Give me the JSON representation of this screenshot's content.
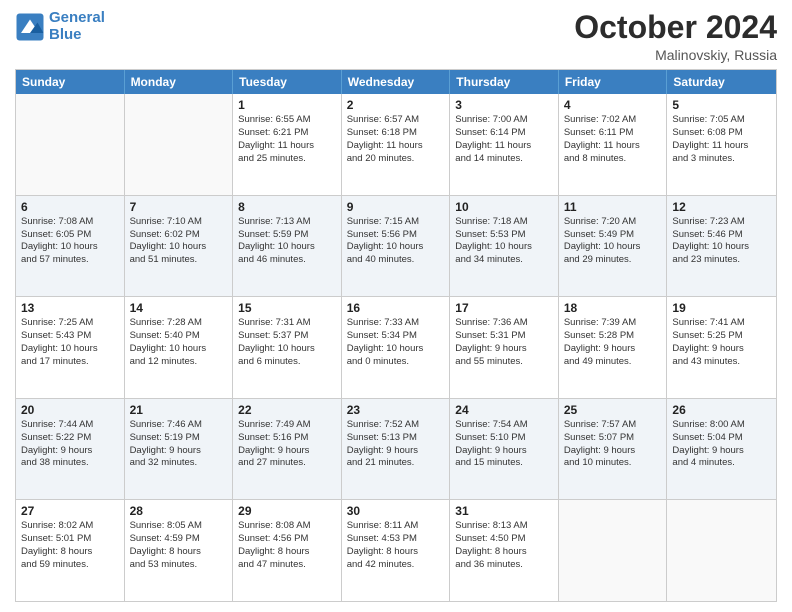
{
  "header": {
    "logo_line1": "General",
    "logo_line2": "Blue",
    "month": "October 2024",
    "location": "Malinovskiy, Russia"
  },
  "weekdays": [
    "Sunday",
    "Monday",
    "Tuesday",
    "Wednesday",
    "Thursday",
    "Friday",
    "Saturday"
  ],
  "rows": [
    [
      {
        "day": "",
        "detail": ""
      },
      {
        "day": "",
        "detail": ""
      },
      {
        "day": "1",
        "detail": "Sunrise: 6:55 AM\nSunset: 6:21 PM\nDaylight: 11 hours\nand 25 minutes."
      },
      {
        "day": "2",
        "detail": "Sunrise: 6:57 AM\nSunset: 6:18 PM\nDaylight: 11 hours\nand 20 minutes."
      },
      {
        "day": "3",
        "detail": "Sunrise: 7:00 AM\nSunset: 6:14 PM\nDaylight: 11 hours\nand 14 minutes."
      },
      {
        "day": "4",
        "detail": "Sunrise: 7:02 AM\nSunset: 6:11 PM\nDaylight: 11 hours\nand 8 minutes."
      },
      {
        "day": "5",
        "detail": "Sunrise: 7:05 AM\nSunset: 6:08 PM\nDaylight: 11 hours\nand 3 minutes."
      }
    ],
    [
      {
        "day": "6",
        "detail": "Sunrise: 7:08 AM\nSunset: 6:05 PM\nDaylight: 10 hours\nand 57 minutes."
      },
      {
        "day": "7",
        "detail": "Sunrise: 7:10 AM\nSunset: 6:02 PM\nDaylight: 10 hours\nand 51 minutes."
      },
      {
        "day": "8",
        "detail": "Sunrise: 7:13 AM\nSunset: 5:59 PM\nDaylight: 10 hours\nand 46 minutes."
      },
      {
        "day": "9",
        "detail": "Sunrise: 7:15 AM\nSunset: 5:56 PM\nDaylight: 10 hours\nand 40 minutes."
      },
      {
        "day": "10",
        "detail": "Sunrise: 7:18 AM\nSunset: 5:53 PM\nDaylight: 10 hours\nand 34 minutes."
      },
      {
        "day": "11",
        "detail": "Sunrise: 7:20 AM\nSunset: 5:49 PM\nDaylight: 10 hours\nand 29 minutes."
      },
      {
        "day": "12",
        "detail": "Sunrise: 7:23 AM\nSunset: 5:46 PM\nDaylight: 10 hours\nand 23 minutes."
      }
    ],
    [
      {
        "day": "13",
        "detail": "Sunrise: 7:25 AM\nSunset: 5:43 PM\nDaylight: 10 hours\nand 17 minutes."
      },
      {
        "day": "14",
        "detail": "Sunrise: 7:28 AM\nSunset: 5:40 PM\nDaylight: 10 hours\nand 12 minutes."
      },
      {
        "day": "15",
        "detail": "Sunrise: 7:31 AM\nSunset: 5:37 PM\nDaylight: 10 hours\nand 6 minutes."
      },
      {
        "day": "16",
        "detail": "Sunrise: 7:33 AM\nSunset: 5:34 PM\nDaylight: 10 hours\nand 0 minutes."
      },
      {
        "day": "17",
        "detail": "Sunrise: 7:36 AM\nSunset: 5:31 PM\nDaylight: 9 hours\nand 55 minutes."
      },
      {
        "day": "18",
        "detail": "Sunrise: 7:39 AM\nSunset: 5:28 PM\nDaylight: 9 hours\nand 49 minutes."
      },
      {
        "day": "19",
        "detail": "Sunrise: 7:41 AM\nSunset: 5:25 PM\nDaylight: 9 hours\nand 43 minutes."
      }
    ],
    [
      {
        "day": "20",
        "detail": "Sunrise: 7:44 AM\nSunset: 5:22 PM\nDaylight: 9 hours\nand 38 minutes."
      },
      {
        "day": "21",
        "detail": "Sunrise: 7:46 AM\nSunset: 5:19 PM\nDaylight: 9 hours\nand 32 minutes."
      },
      {
        "day": "22",
        "detail": "Sunrise: 7:49 AM\nSunset: 5:16 PM\nDaylight: 9 hours\nand 27 minutes."
      },
      {
        "day": "23",
        "detail": "Sunrise: 7:52 AM\nSunset: 5:13 PM\nDaylight: 9 hours\nand 21 minutes."
      },
      {
        "day": "24",
        "detail": "Sunrise: 7:54 AM\nSunset: 5:10 PM\nDaylight: 9 hours\nand 15 minutes."
      },
      {
        "day": "25",
        "detail": "Sunrise: 7:57 AM\nSunset: 5:07 PM\nDaylight: 9 hours\nand 10 minutes."
      },
      {
        "day": "26",
        "detail": "Sunrise: 8:00 AM\nSunset: 5:04 PM\nDaylight: 9 hours\nand 4 minutes."
      }
    ],
    [
      {
        "day": "27",
        "detail": "Sunrise: 8:02 AM\nSunset: 5:01 PM\nDaylight: 8 hours\nand 59 minutes."
      },
      {
        "day": "28",
        "detail": "Sunrise: 8:05 AM\nSunset: 4:59 PM\nDaylight: 8 hours\nand 53 minutes."
      },
      {
        "day": "29",
        "detail": "Sunrise: 8:08 AM\nSunset: 4:56 PM\nDaylight: 8 hours\nand 47 minutes."
      },
      {
        "day": "30",
        "detail": "Sunrise: 8:11 AM\nSunset: 4:53 PM\nDaylight: 8 hours\nand 42 minutes."
      },
      {
        "day": "31",
        "detail": "Sunrise: 8:13 AM\nSunset: 4:50 PM\nDaylight: 8 hours\nand 36 minutes."
      },
      {
        "day": "",
        "detail": ""
      },
      {
        "day": "",
        "detail": ""
      }
    ]
  ]
}
